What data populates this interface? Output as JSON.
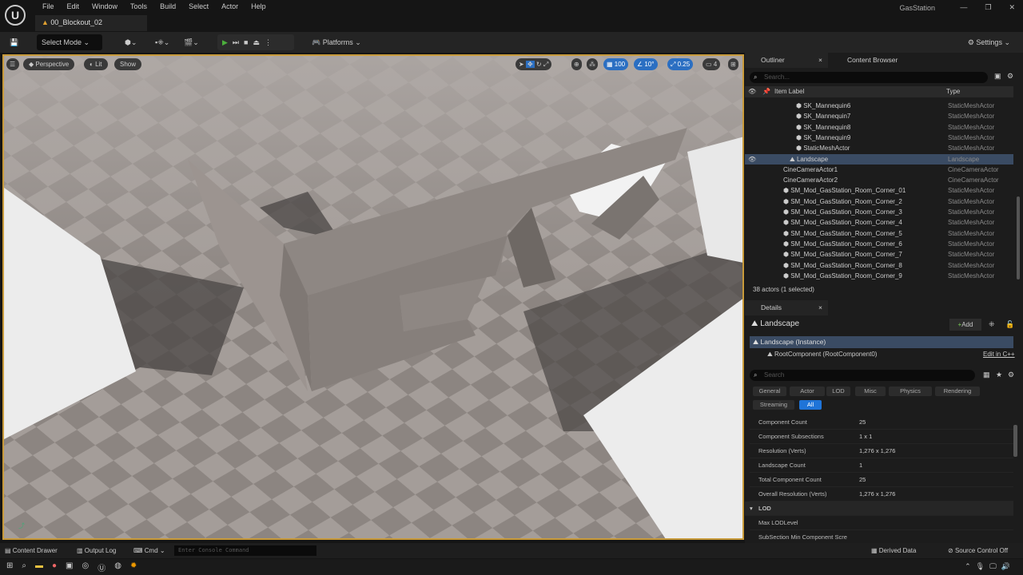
{
  "menubar": {
    "items": [
      "File",
      "Edit",
      "Window",
      "Tools",
      "Build",
      "Select",
      "Actor",
      "Help"
    ],
    "level_tab": "00_Blockout_02",
    "project": "GasStation"
  },
  "toolbar": {
    "select_mode": "Select Mode",
    "platforms": "Platforms",
    "settings": "Settings"
  },
  "viewport": {
    "perspective": "Perspective",
    "lit": "Lit",
    "show": "Show",
    "grid_snap": "100",
    "rotation_snap": "10°",
    "scale_snap": "0.25",
    "camera_speed": "4"
  },
  "outliner": {
    "tab": "Outliner",
    "content_browser_tab": "Content Browser",
    "search_placeholder": "Search...",
    "col_label": "Item Label",
    "col_type": "Type",
    "rows": [
      {
        "label": "SK_Mannequin6",
        "type": "StaticMeshActor",
        "depth": 3
      },
      {
        "label": "SK_Mannequin7",
        "type": "StaticMeshActor",
        "depth": 3
      },
      {
        "label": "SK_Mannequin8",
        "type": "StaticMeshActor",
        "depth": 3
      },
      {
        "label": "SK_Mannequin9",
        "type": "StaticMeshActor",
        "depth": 3
      },
      {
        "label": "StaticMeshActor",
        "type": "StaticMeshActor",
        "depth": 3
      },
      {
        "label": "Landscape",
        "type": "Landscape",
        "depth": 2,
        "selected": true
      },
      {
        "label": "CineCameraActor1",
        "type": "CineCameraActor",
        "depth": 1
      },
      {
        "label": "CineCameraActor2",
        "type": "CineCameraActor",
        "depth": 1
      },
      {
        "label": "SM_Mod_GasStation_Room_Corner_01",
        "type": "StaticMeshActor",
        "depth": 1
      },
      {
        "label": "SM_Mod_GasStation_Room_Corner_2",
        "type": "StaticMeshActor",
        "depth": 1
      },
      {
        "label": "SM_Mod_GasStation_Room_Corner_3",
        "type": "StaticMeshActor",
        "depth": 1
      },
      {
        "label": "SM_Mod_GasStation_Room_Corner_4",
        "type": "StaticMeshActor",
        "depth": 1
      },
      {
        "label": "SM_Mod_GasStation_Room_Corner_5",
        "type": "StaticMeshActor",
        "depth": 1
      },
      {
        "label": "SM_Mod_GasStation_Room_Corner_6",
        "type": "StaticMeshActor",
        "depth": 1
      },
      {
        "label": "SM_Mod_GasStation_Room_Corner_7",
        "type": "StaticMeshActor",
        "depth": 1
      },
      {
        "label": "SM_Mod_GasStation_Room_Corner_8",
        "type": "StaticMeshActor",
        "depth": 1
      },
      {
        "label": "SM_Mod_GasStation_Room_Corner_9",
        "type": "StaticMeshActor",
        "depth": 1
      }
    ],
    "status": "38 actors (1 selected)"
  },
  "details": {
    "tab": "Details",
    "actor": "Landscape",
    "add": "Add",
    "instance": "Landscape (Instance)",
    "root": "RootComponent (RootComponent0)",
    "edit_cpp": "Edit in C++",
    "search_placeholder": "Search",
    "filters": [
      "General",
      "Actor",
      "LOD",
      "Misc",
      "Physics",
      "Rendering",
      "Streaming",
      "All"
    ],
    "active_filter": "All",
    "properties": [
      {
        "key": "Component Count",
        "value": "25"
      },
      {
        "key": "Component Subsections",
        "value": "1 x 1"
      },
      {
        "key": "Resolution (Verts)",
        "value": "1,276 x 1,276"
      },
      {
        "key": "Landscape Count",
        "value": "1"
      },
      {
        "key": "Total Component Count",
        "value": "25"
      },
      {
        "key": "Overall Resolution (Verts)",
        "value": "1,276 x 1,276"
      }
    ],
    "lod_section": "LOD",
    "lod_properties": [
      {
        "key": "Max LODLevel",
        "value": ""
      },
      {
        "key": "SubSection Min Component Scre",
        "value": ""
      }
    ]
  },
  "bottombar": {
    "content_drawer": "Content Drawer",
    "output_log": "Output Log",
    "cmd": "Cmd",
    "console_placeholder": "Enter Console Command",
    "derived_data": "Derived Data",
    "source_control": "Source Control Off"
  },
  "colors": {
    "accent": "#2b6fc2",
    "selection": "#3a4b63",
    "viewport_border": "#c89a3a",
    "play": "#4caf3c"
  }
}
